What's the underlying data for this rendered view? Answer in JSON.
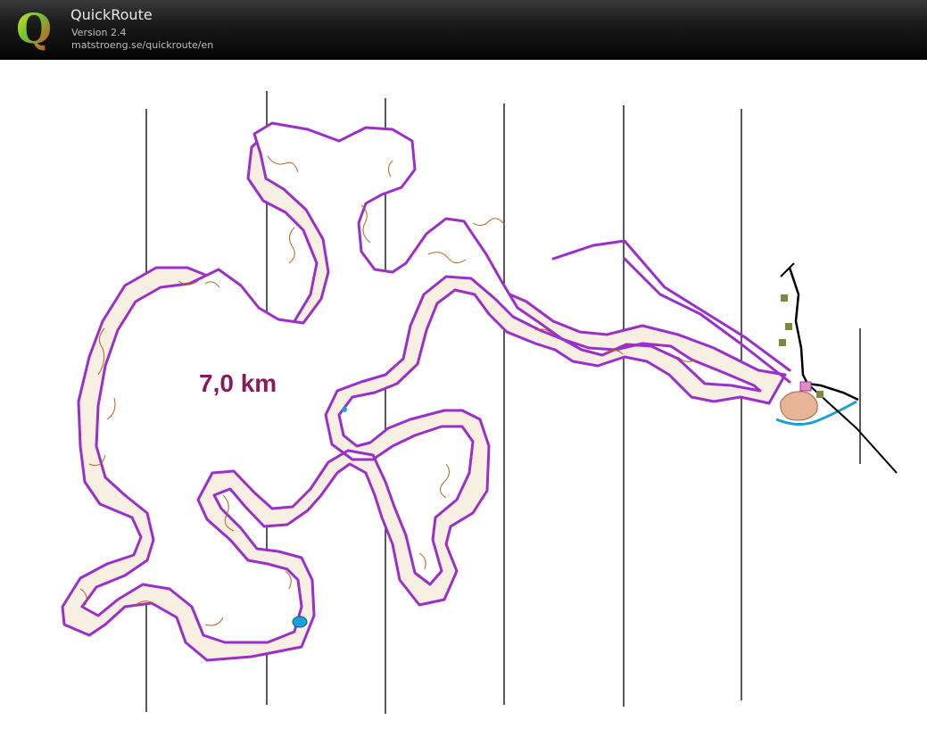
{
  "app": {
    "title": "QuickRoute",
    "version": "Version 2.4",
    "url": "matstroeng.se/quickroute/en",
    "logo_letter": "Q"
  },
  "map": {
    "distance_label": "7,0 km",
    "colors": {
      "course": "#9b2fc9",
      "contours": "#b5651d",
      "north_lines": "#000000",
      "distance_text": "#8b1a5c",
      "water": "#1aa0d8",
      "terrain_fill": "#f6efe2"
    }
  }
}
